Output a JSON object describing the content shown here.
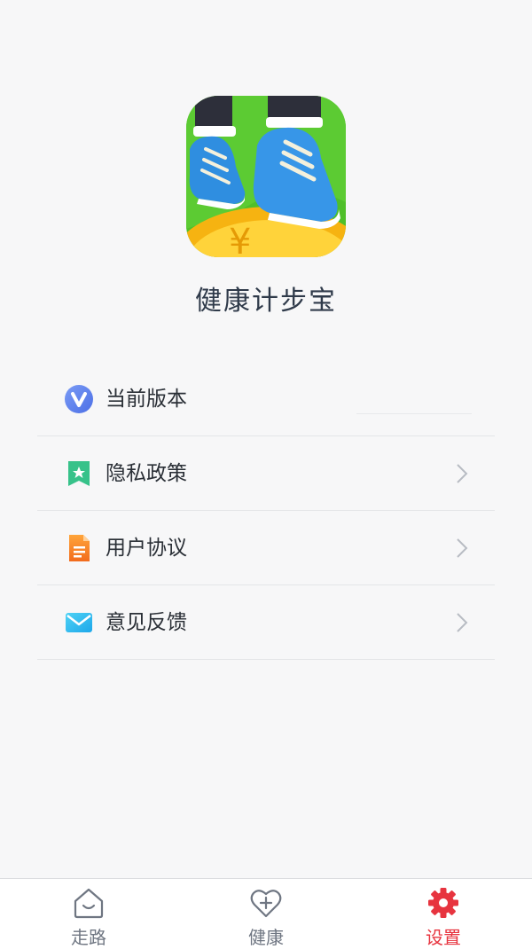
{
  "app": {
    "name": "健康计步宝",
    "logo": "sneakers-on-gold-coin-logo"
  },
  "menu": {
    "items": [
      {
        "label": "当前版本",
        "icon": "version-v-icon",
        "value": ""
      },
      {
        "label": "隐私政策",
        "icon": "bookmark-star-icon"
      },
      {
        "label": "用户协议",
        "icon": "document-icon"
      },
      {
        "label": "意见反馈",
        "icon": "envelope-icon"
      }
    ]
  },
  "tabbar": {
    "tabs": [
      {
        "label": "走路",
        "icon": "house-smile-icon",
        "active": false
      },
      {
        "label": "健康",
        "icon": "heart-plus-icon",
        "active": false
      },
      {
        "label": "设置",
        "icon": "gear-icon",
        "active": true
      }
    ]
  },
  "colors": {
    "accent": "#e7343f",
    "text": "#2a2f36",
    "inactive": "#6f7682"
  }
}
